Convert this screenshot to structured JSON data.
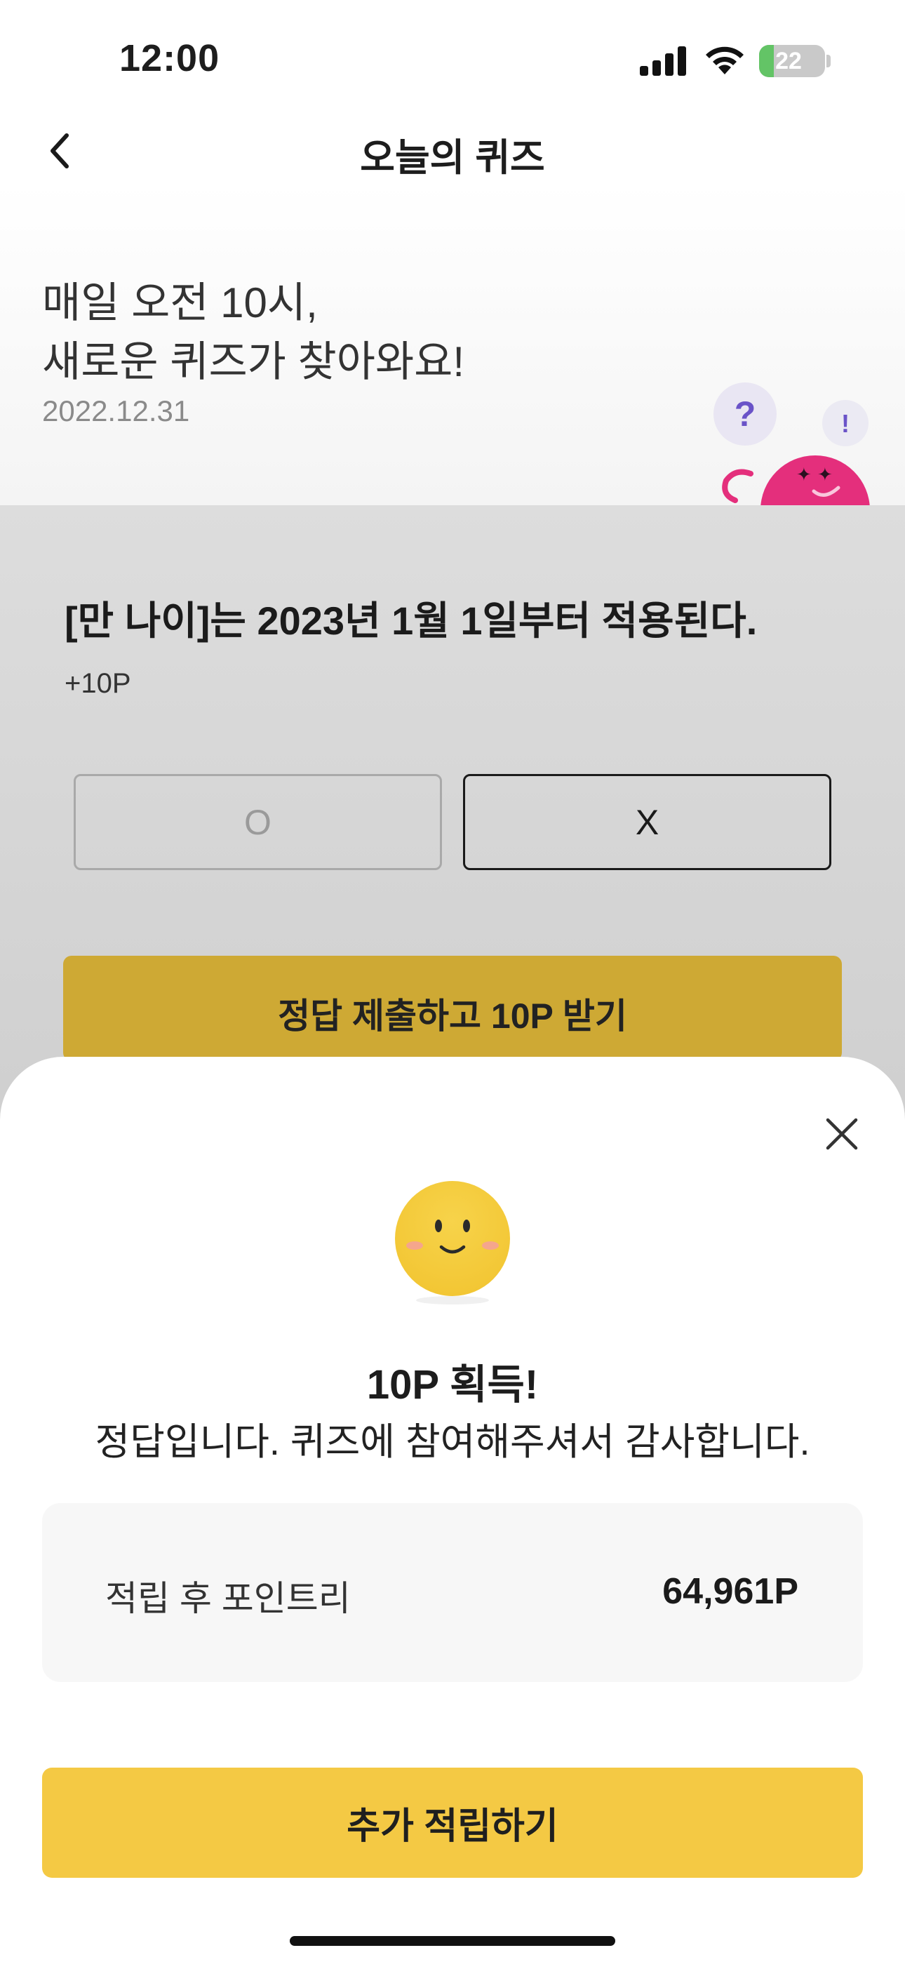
{
  "status_bar": {
    "time": "12:00",
    "battery_level": "22",
    "battery_fraction": 0.22,
    "icons": [
      "signal-icon",
      "wifi-icon",
      "battery-icon"
    ]
  },
  "nav": {
    "title": "오늘의 퀴즈",
    "back_icon": "chevron-left-icon"
  },
  "hero": {
    "headline_line1": "매일 오전 10시,",
    "headline_line2": "새로운 퀴즈가 찾아와요!",
    "date": "2022.12.31",
    "mascot_question_mark": "?",
    "mascot_exclaim_mark": "!"
  },
  "quiz": {
    "question": "[만 나이]는 2023년 1월 1일부터 적용된다.",
    "points": "+10P",
    "options": [
      {
        "label": "O",
        "selected": false
      },
      {
        "label": "X",
        "selected": true
      }
    ],
    "submit_label": "정답 제출하고 10P 받기"
  },
  "result_sheet": {
    "close_icon": "close-icon",
    "title": "10P 획득!",
    "message": "정답입니다. 퀴즈에 참여해주셔서 감사합니다.",
    "points_label": "적립 후 포인트리",
    "points_value": "64,961P",
    "cta_label": "추가 적립하기"
  },
  "colors": {
    "accent_yellow": "#f4c944",
    "dimmed_yellow": "#cea934",
    "mascot_pink": "#e42f7c",
    "smiley_yellow": "#f5cb3a"
  }
}
